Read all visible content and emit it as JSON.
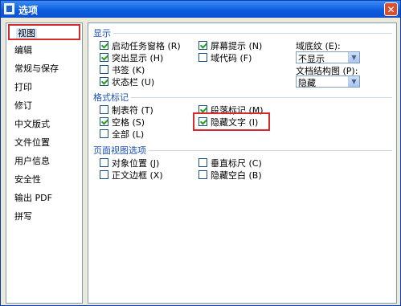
{
  "window": {
    "title": "选项",
    "close_glyph": "✕",
    "app_icon": "document-icon"
  },
  "sidebar": {
    "items": [
      {
        "label": "视图",
        "selected": true
      },
      {
        "label": "编辑"
      },
      {
        "label": "常规与保存"
      },
      {
        "label": "打印"
      },
      {
        "label": "修订"
      },
      {
        "label": "中文版式"
      },
      {
        "label": "文件位置"
      },
      {
        "label": "用户信息"
      },
      {
        "label": "安全性"
      },
      {
        "label": "输出 PDF"
      },
      {
        "label": "拼写"
      }
    ]
  },
  "display": {
    "title": "显示",
    "startup_pane": {
      "label": "启动任务窗格 (R)",
      "checked": true
    },
    "screen_tips": {
      "label": "屏幕提示 (N)",
      "checked": true
    },
    "highlight": {
      "label": "突出显示 (H)",
      "checked": true
    },
    "field_codes": {
      "label": "域代码 (F)",
      "checked": false
    },
    "bookmarks": {
      "label": "书签 (K)",
      "checked": false
    },
    "status_bar": {
      "label": "状态栏 (U)",
      "checked": true
    },
    "field_shading": {
      "label": "域底纹 (E):",
      "value": "不显示"
    },
    "doc_map": {
      "label": "文档结构图 (P):",
      "value": "隐藏"
    }
  },
  "formatting_marks": {
    "title": "格式标记",
    "tabs": {
      "label": "制表符 (T)",
      "checked": false
    },
    "paragraph_marks": {
      "label": "段落标记 (M)",
      "checked": true
    },
    "spaces": {
      "label": "空格 (S)",
      "checked": true
    },
    "hidden_text": {
      "label": "隐藏文字 (I)",
      "checked": true
    },
    "all": {
      "label": "全部 (L)",
      "checked": false
    }
  },
  "page_view": {
    "title": "页面视图选项",
    "object_anchors": {
      "label": "对象位置 (J)",
      "checked": false
    },
    "vertical_ruler": {
      "label": "垂直标尺 (C)",
      "checked": false
    },
    "text_boundaries": {
      "label": "正文边框 (X)",
      "checked": false
    },
    "hide_white_space": {
      "label": "隐藏空白 (B)",
      "checked": false
    }
  },
  "colors": {
    "accent": "#1b4fb6",
    "highlight_box": "#d72b2b",
    "check": "#21a121"
  }
}
